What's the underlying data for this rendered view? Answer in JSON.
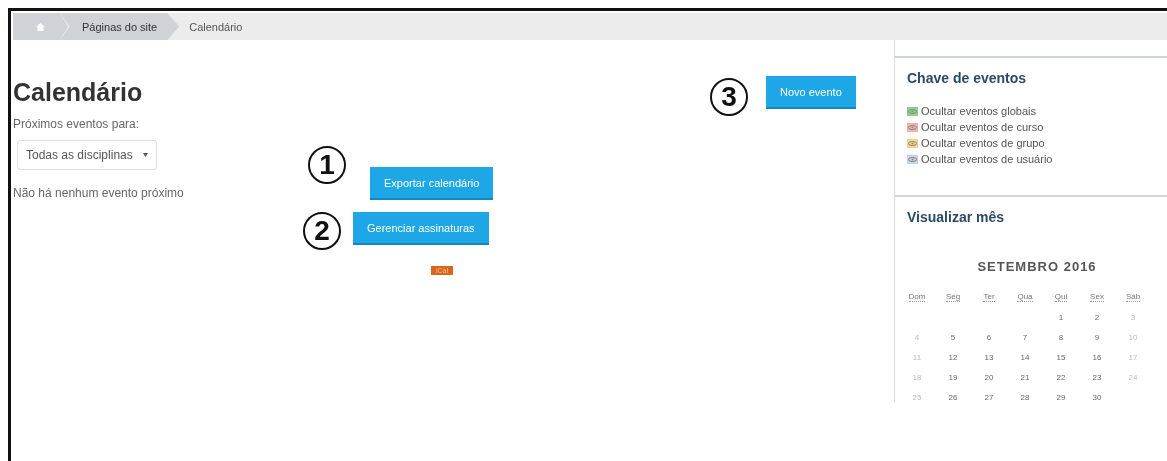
{
  "breadcrumb": [
    {
      "label": "Páginas do site",
      "kind": "link"
    },
    {
      "label": "Calendário",
      "kind": "current"
    }
  ],
  "title": "Calendário",
  "upcoming": {
    "label": "Próximos eventos para:",
    "select_value": "Todas as disciplinas",
    "empty_message": "Não há nenhum evento próximo"
  },
  "annotations": [
    {
      "number": "3",
      "button": "Novo evento"
    },
    {
      "number": "1",
      "button": "Exportar calendário"
    },
    {
      "number": "2",
      "button": "Gerenciar assinaturas"
    }
  ],
  "ical_badge": "iCal",
  "event_key": {
    "title": "Chave de eventos",
    "items": [
      {
        "label": "Ocultar eventos globais",
        "color": "#8fcf8a"
      },
      {
        "label": "Ocultar eventos de curso",
        "color": "#f0b3a8"
      },
      {
        "label": "Ocultar eventos de grupo",
        "color": "#f3d58a"
      },
      {
        "label": "Ocultar eventos de usuário",
        "color": "#c4d3e8"
      }
    ]
  },
  "month_view": {
    "title": "Visualizar mês",
    "month": "SETEMBRO 2016",
    "weekdays": [
      "Dom",
      "Seg",
      "Ter",
      "Qua",
      "Qui",
      "Sex",
      "Sáb"
    ],
    "weeks": [
      [
        "1",
        "2",
        "3"
      ],
      [
        "4",
        "5",
        "6",
        "7",
        "8",
        "9",
        "10"
      ],
      [
        "11",
        "12",
        "13",
        "14",
        "15",
        "16",
        "17"
      ],
      [
        "18",
        "19",
        "20",
        "21",
        "22",
        "23",
        "24"
      ],
      [
        "25",
        "26",
        "27",
        "28",
        "29",
        "30"
      ]
    ]
  }
}
